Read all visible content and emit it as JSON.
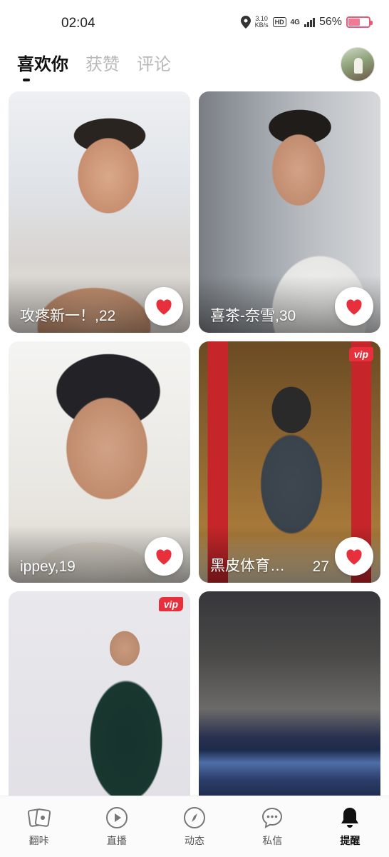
{
  "status_bar": {
    "time": "02:04",
    "net_speed_value": "3.10",
    "net_speed_unit": "KB/s",
    "hd_badge": "HD",
    "network": "4G",
    "battery_text": "56%",
    "battery_level": 0.56
  },
  "header": {
    "tabs": [
      {
        "label": "喜欢你",
        "active": true
      },
      {
        "label": "获赞",
        "active": false
      },
      {
        "label": "评论",
        "active": false
      }
    ]
  },
  "cards": [
    {
      "name": "攻疼新一！,22",
      "age": "",
      "vip": "",
      "liked_icon": "heart-icon"
    },
    {
      "name": "喜茶-奈雪,30",
      "age": "",
      "vip": "",
      "liked_icon": "heart-icon"
    },
    {
      "name": "ippey,19",
      "age": "",
      "vip": "",
      "liked_icon": "heart-icon"
    },
    {
      "name": "黑皮体育…",
      "age": "27",
      "vip": "vip",
      "liked_icon": "heart-icon"
    },
    {
      "name": "",
      "age": "",
      "vip": "vip",
      "liked_icon": "heart-icon"
    },
    {
      "name": "",
      "age": "",
      "vip": "",
      "liked_icon": "heart-icon"
    }
  ],
  "bottom_nav": [
    {
      "label": "翻咔",
      "icon": "cards-icon",
      "active": false
    },
    {
      "label": "直播",
      "icon": "play-icon",
      "active": false
    },
    {
      "label": "动态",
      "icon": "compass-icon",
      "active": false
    },
    {
      "label": "私信",
      "icon": "chat-icon",
      "active": false
    },
    {
      "label": "提醒",
      "icon": "bell-icon",
      "active": true
    }
  ],
  "colors": {
    "like_heart": "#e8303c",
    "vip_badge": "#e8303c",
    "battery": "#f07a96"
  }
}
